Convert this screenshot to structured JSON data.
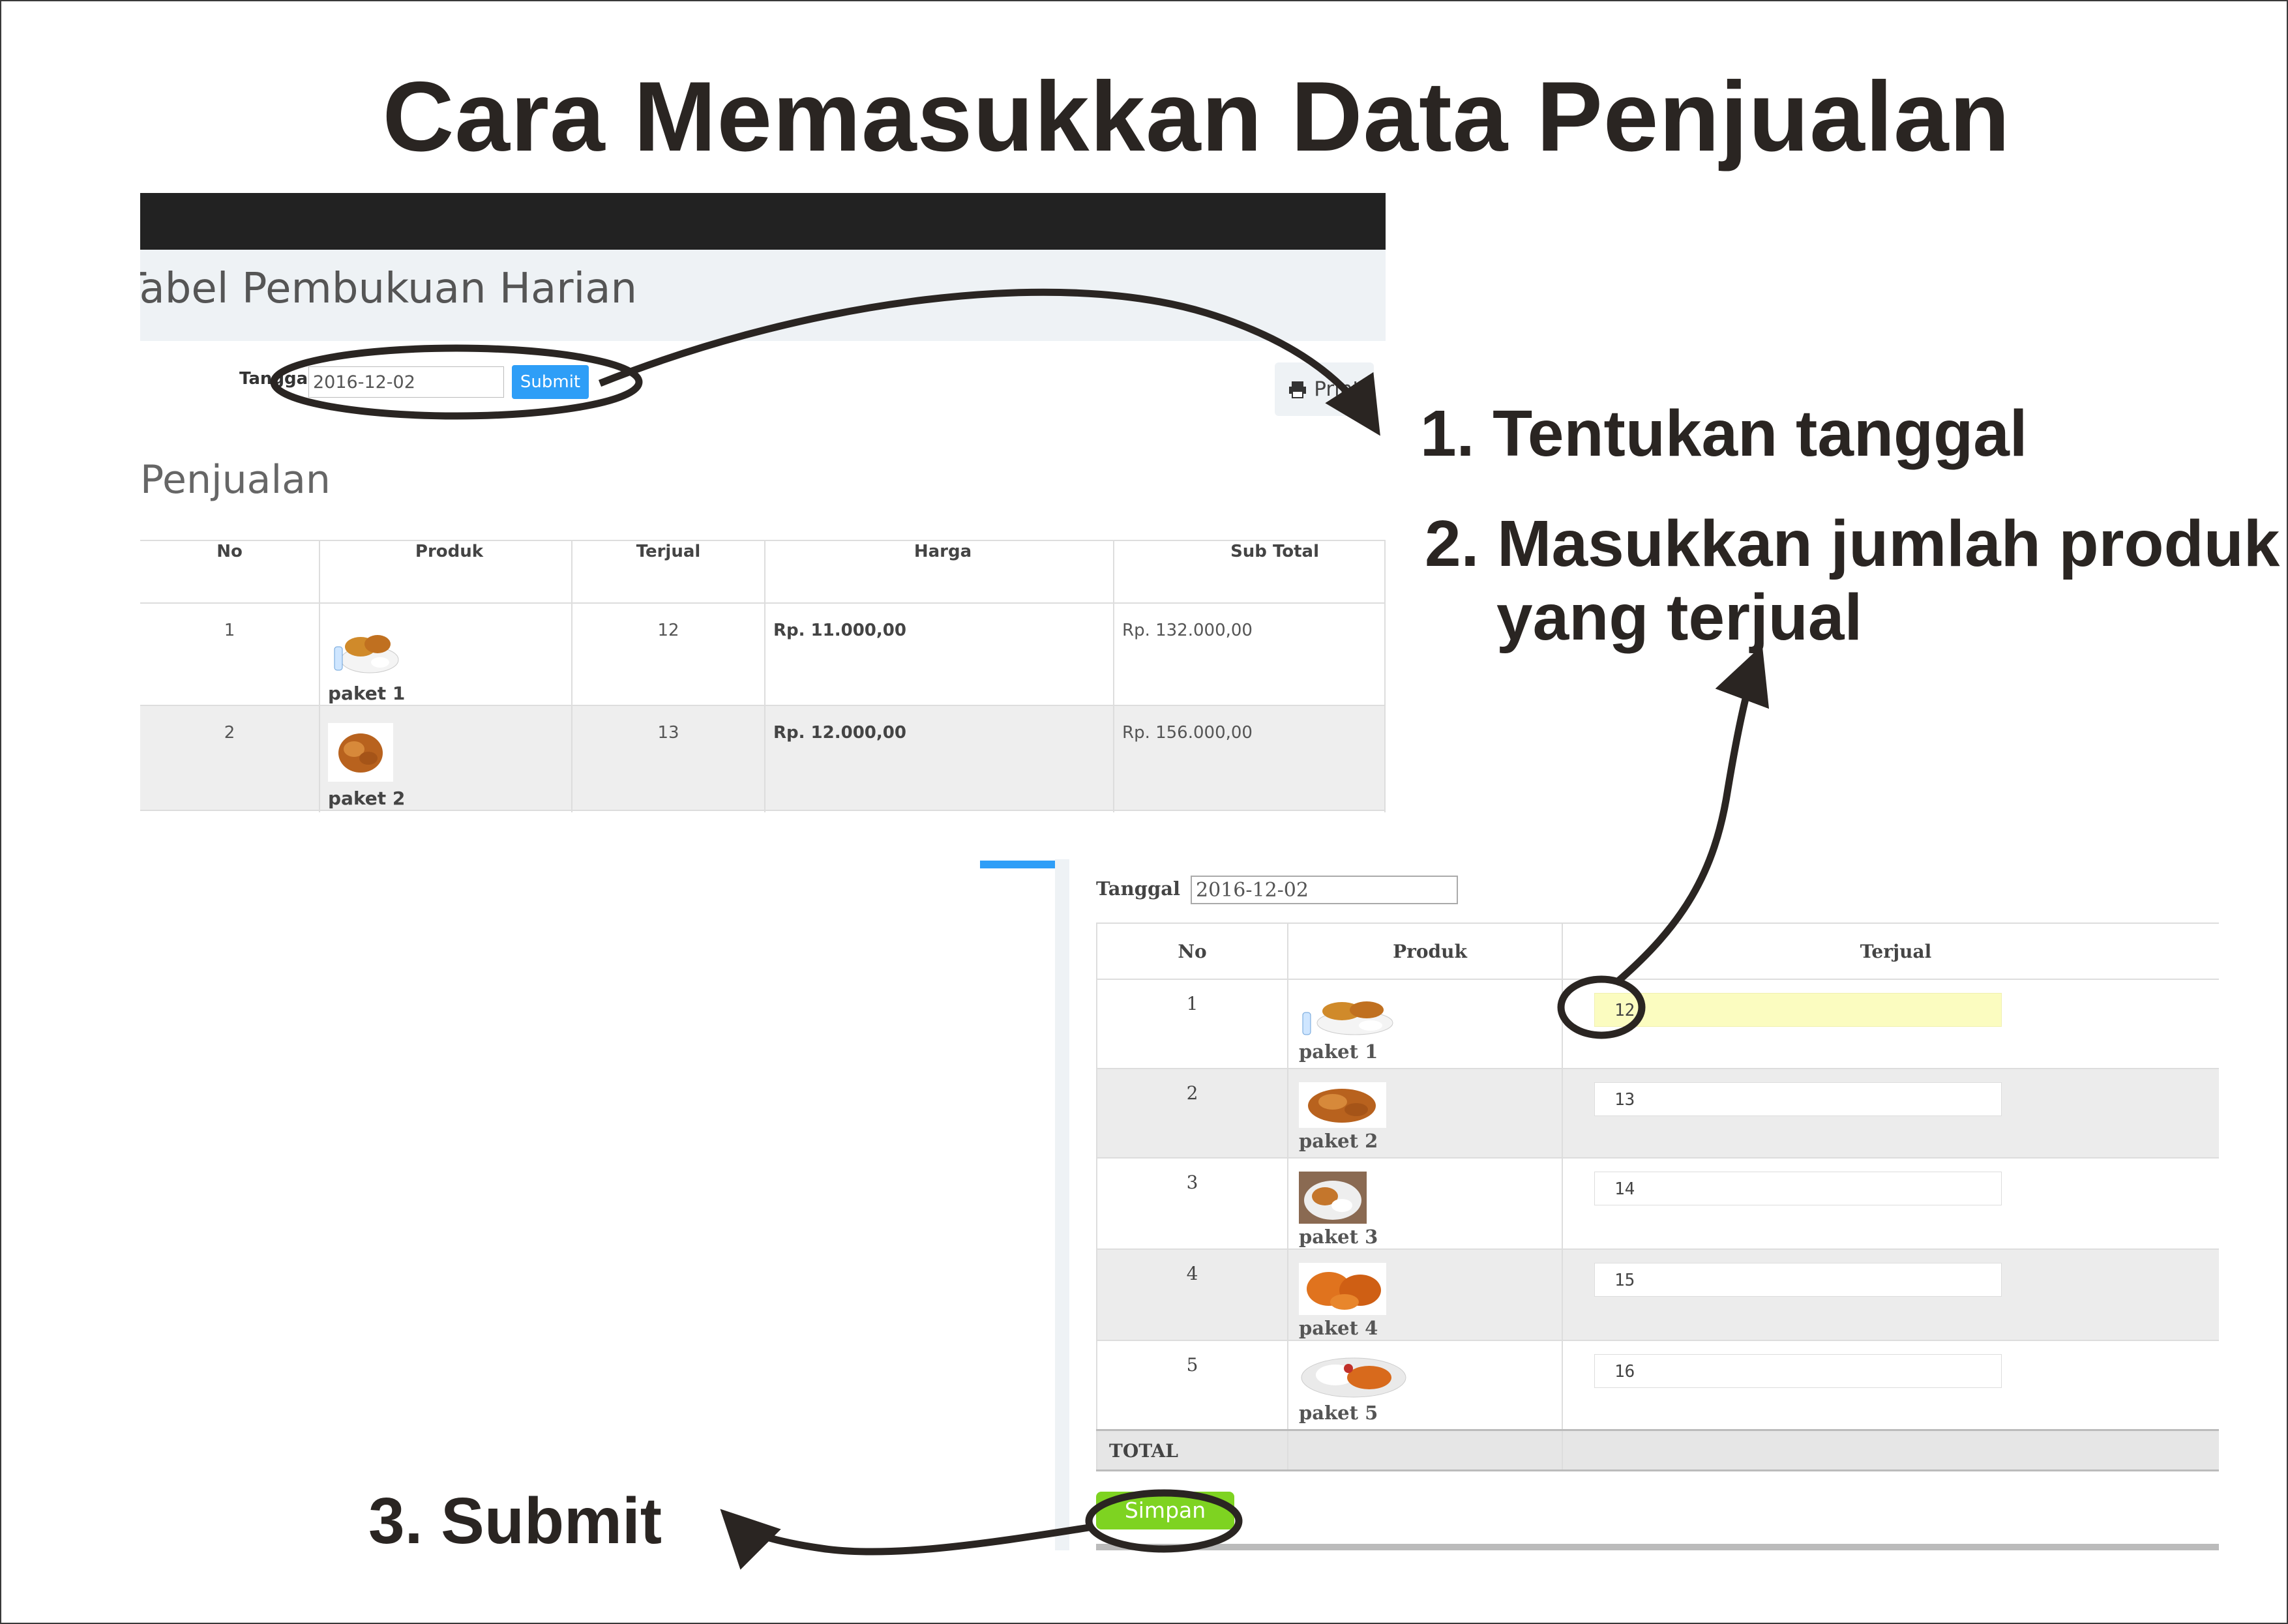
{
  "title": "Cara Memasukkan Data Penjualan",
  "steps": {
    "step1": "1. Tentukan tanggal",
    "step2_line1": "2. Masukkan jumlah produk",
    "step2_line2": "yang terjual",
    "step3": "3. Submit"
  },
  "screenshot1": {
    "header_title": "Tabel Pembukuan Harian",
    "date_label": "Tanggal",
    "date_value": "2016-12-02",
    "submit_label": "Submit",
    "print_label": "Print",
    "section_title": "Penjualan",
    "columns": [
      "No",
      "Produk",
      "Terjual",
      "Harga",
      "Sub Total"
    ],
    "rows": [
      {
        "no": "1",
        "produk": "paket 1",
        "terjual": "12",
        "harga": "Rp. 11.000,00",
        "subtotal": "Rp. 132.000,00"
      },
      {
        "no": "2",
        "produk": "paket 2",
        "terjual": "13",
        "harga": "Rp. 12.000,00",
        "subtotal": "Rp. 156.000,00"
      }
    ]
  },
  "screenshot2": {
    "date_label": "Tanggal",
    "date_value": "2016-12-02",
    "columns": [
      "No",
      "Produk",
      "Terjual"
    ],
    "rows": [
      {
        "no": "1",
        "produk": "paket 1",
        "terjual": "12"
      },
      {
        "no": "2",
        "produk": "paket 2",
        "terjual": "13"
      },
      {
        "no": "3",
        "produk": "paket 3",
        "terjual": "14"
      },
      {
        "no": "4",
        "produk": "paket 4",
        "terjual": "15"
      },
      {
        "no": "5",
        "produk": "paket 5",
        "terjual": "16"
      }
    ],
    "total_label": "TOTAL",
    "save_label": "Simpan"
  },
  "colors": {
    "submit_blue": "#2e9ef7",
    "save_green": "#7ed321",
    "active_input": "#fbfcc0",
    "annotation": "#2a2522"
  }
}
